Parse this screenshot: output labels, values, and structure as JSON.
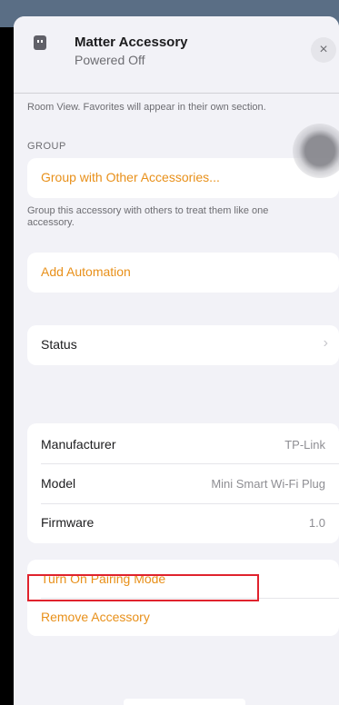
{
  "header": {
    "title": "Matter Accessory",
    "subtitle": "Powered Off",
    "close_glyph": "×",
    "icon": "plug-icon"
  },
  "room_note": "Room View. Favorites will appear in their own section.",
  "group": {
    "section_label": "GROUP",
    "action_label": "Group with Other Accessories...",
    "footnote": "Group this accessory with others to treat them like one accessory."
  },
  "automation": {
    "label": "Add Automation"
  },
  "status": {
    "label": "Status",
    "chevron_glyph": "›"
  },
  "info": {
    "rows": [
      {
        "label": "Manufacturer",
        "value": "TP-Link"
      },
      {
        "label": "Model",
        "value": "Mini Smart Wi-Fi Plug"
      },
      {
        "label": "Firmware",
        "value": "1.0"
      }
    ]
  },
  "actions": {
    "pairing_label": "Turn On Pairing Mode",
    "remove_label": "Remove Accessory"
  },
  "colors": {
    "accent": "#e8901a",
    "highlight_border": "#e0222d",
    "sheet_background": "#f2f2f7"
  }
}
